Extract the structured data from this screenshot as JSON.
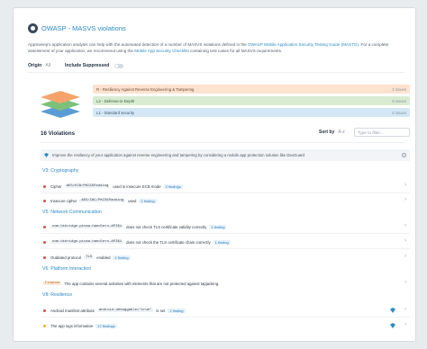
{
  "header": {
    "title": "OWASP - MASVS violations"
  },
  "description": {
    "before": "AppSweep's application analysis can help with the automated detection of a number of MASVS violations defined in the ",
    "link1": "OWASP Mobile Application Security Testing Guide (MASTG)",
    "middle": ". For a complete assessment of your application, we recommend using the ",
    "link2": "Mobile App Security Checklist",
    "after": " containing test cases for all MASVS requirements."
  },
  "filters": {
    "origin_label": "Origin",
    "origin_value": "All",
    "suppressed_label": "Include Suppressed"
  },
  "levels": [
    {
      "label": "R - Resiliency Against Reverse Engineering & Tampering",
      "issues": "2 issues",
      "color": "#fde3cf"
    },
    {
      "label": "L2 - Defense-in-Depth",
      "issues": "9 issues",
      "color": "#d8ecd2"
    },
    {
      "label": "L1 - Standard security",
      "issues": "5 issues",
      "color": "#d3e7f6"
    }
  ],
  "violations": {
    "count_label": "16 Violations",
    "sort_label": "Sort by",
    "sort_value": "A-z",
    "filter_placeholder": "Type to filter..."
  },
  "banner": {
    "text": "Improve the resiliency of your application against reverse engineering and tampering by considering a mobile app protection solution like DexGuard"
  },
  "sections": [
    {
      "title": "V3: Cryptography",
      "rows": [
        {
          "pre": "Cipher",
          "code": "AES/ECB/PKCS5Padding",
          "post": "used in insecure ECB mode",
          "findings": "2 findings",
          "severity": "red"
        },
        {
          "pre": "Insecure cipher",
          "code": "AES/CBC/PKCS5Padding",
          "post": "used",
          "findings": "1 finding",
          "severity": "red"
        }
      ]
    },
    {
      "title": "V5: Network Communication",
      "rows": [
        {
          "pre": "",
          "code": "com.htbridge.pivaa.handlers.API$1",
          "post": "does not check TLS certificate validity correctly",
          "findings": "1 finding",
          "severity": "red"
        },
        {
          "pre": "",
          "code": "com.htbridge.pivaa.handlers.API$1",
          "post": "does not check the TLS certificate chain correctly",
          "findings": "1 finding",
          "severity": "red"
        },
        {
          "pre": "Outdated protocol",
          "code": "TLS",
          "post": "enabled",
          "findings": "1 finding",
          "severity": "red"
        }
      ]
    },
    {
      "title": "V6: Platform Interaction",
      "rows": [
        {
          "pre": "",
          "code": "Finance",
          "post": "The app contains several activities with elements that are not protected against tapjacking.",
          "findings": "",
          "severity": "none"
        }
      ]
    },
    {
      "title": "V8: Resilience",
      "rows": [
        {
          "pre": "Android manifest attribute",
          "code": "android:debuggable=\"true\"",
          "post": "is set",
          "findings": "1 finding",
          "severity": "red"
        },
        {
          "pre": "The app logs information",
          "code": "",
          "post": "",
          "findings": "17 findings",
          "severity": "amber"
        }
      ]
    }
  ],
  "icons": {
    "chevron": "chevron-right-icon",
    "dexguard": "dexguard-icon",
    "owasp": "owasp-logo-icon"
  }
}
